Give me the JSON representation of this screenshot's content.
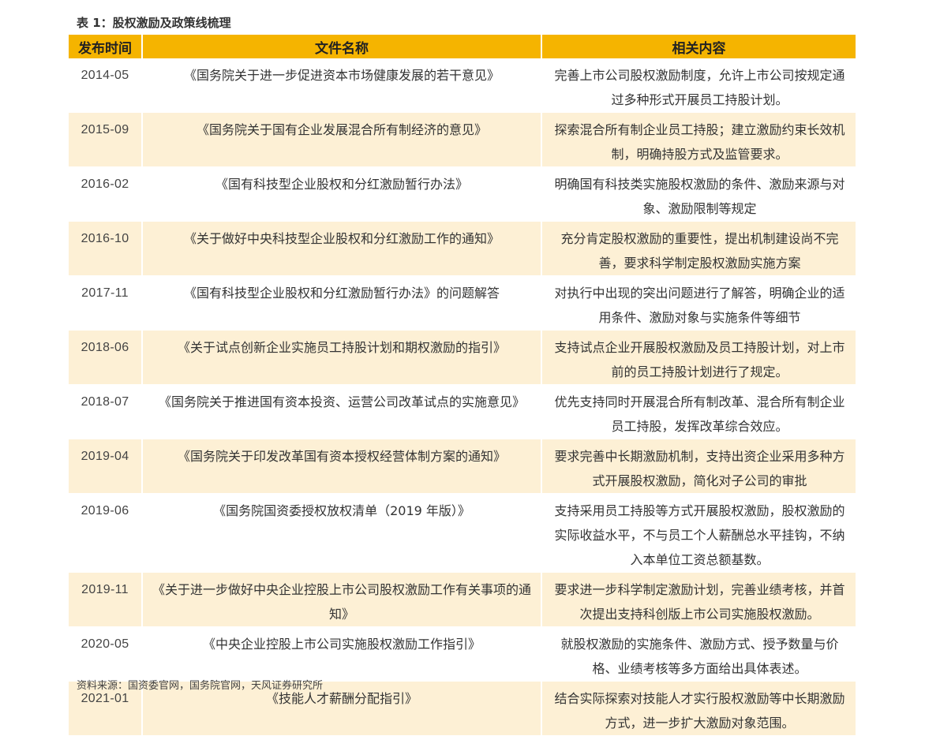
{
  "caption": "表 1：股权激励及政策线梳理",
  "table": {
    "headers": {
      "date": "发布时间",
      "document": "文件名称",
      "content": "相关内容"
    },
    "rows": [
      {
        "date": "2014-05",
        "document": "《国务院关于进一步促进资本市场健康发展的若干意见》",
        "content": "完善上市公司股权激励制度，允许上市公司按规定通过多种形式开展员工持股计划。"
      },
      {
        "date": "2015-09",
        "document": "《国务院关于国有企业发展混合所有制经济的意见》",
        "content": "探索混合所有制企业员工持股；建立激励约束长效机制，明确持股方式及监管要求。"
      },
      {
        "date": "2016-02",
        "document": "《国有科技型企业股权和分红激励暂行办法》",
        "content": "明确国有科技类实施股权激励的条件、激励来源与对象、激励限制等规定"
      },
      {
        "date": "2016-10",
        "document": "《关于做好中央科技型企业股权和分红激励工作的通知》",
        "content": "充分肯定股权激励的重要性，提出机制建设尚不完善，要求科学制定股权激励实施方案"
      },
      {
        "date": "2017-11",
        "document": "《国有科技型企业股权和分红激励暂行办法》的问题解答",
        "content": "对执行中出现的突出问题进行了解答，明确企业的适用条件、激励对象与实施条件等细节"
      },
      {
        "date": "2018-06",
        "document": "《关于试点创新企业实施员工持股计划和期权激励的指引》",
        "content": "支持试点企业开展股权激励及员工持股计划，对上市前的员工持股计划进行了规定。"
      },
      {
        "date": "2018-07",
        "document": "《国务院关于推进国有资本投资、运营公司改革试点的实施意见》",
        "content": "优先支持同时开展混合所有制改革、混合所有制企业员工持股，发挥改革综合效应。"
      },
      {
        "date": "2019-04",
        "document": "《国务院关于印发改革国有资本授权经营体制方案的通知》",
        "content": "要求完善中长期激励机制，支持出资企业采用多种方式开展股权激励，简化对子公司的审批"
      },
      {
        "date": "2019-06",
        "document": "《国务院国资委授权放权清单（2019 年版）》",
        "content": "支持采用员工持股等方式开展股权激励，股权激励的实际收益水平，不与员工个人薪酬总水平挂钩，不纳入本单位工资总额基数。"
      },
      {
        "date": "2019-11",
        "document": "《关于进一步做好中央企业控股上市公司股权激励工作有关事项的通知》",
        "content": "要求进一步科学制定激励计划，完善业绩考核，并首次提出支持科创版上市公司实施股权激励。"
      },
      {
        "date": "2020-05",
        "document": "《中央企业控股上市公司实施股权激励工作指引》",
        "content": "就股权激励的实施条件、激励方式、授予数量与价格、业绩考核等多方面给出具体表述。"
      },
      {
        "date": "2021-01",
        "document": "《技能人才薪酬分配指引》",
        "content": "结合实际探索对技能人才实行股权激励等中长期激励方式，进一步扩大激励对象范围。"
      }
    ]
  },
  "source": "资料来源：国资委官网，国务院官网，天风证券研究所",
  "colors": {
    "header_background": "#f5b400",
    "shaded_row_background": "#fdf0d5"
  }
}
